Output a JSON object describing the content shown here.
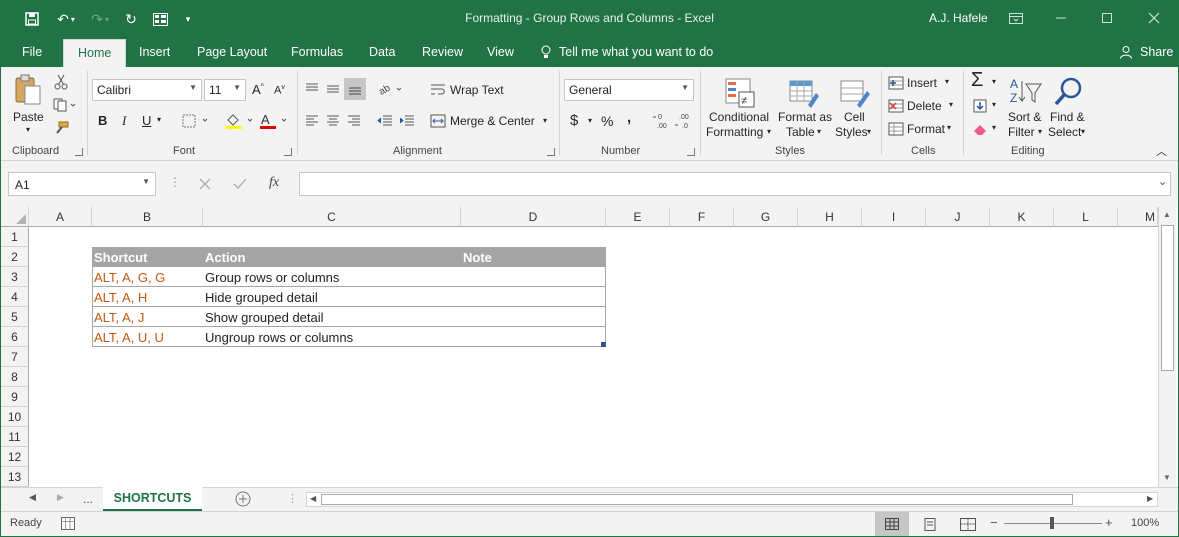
{
  "window": {
    "title": "Formatting - Group Rows and Columns  -  Excel",
    "user": "A.J. Hafele"
  },
  "tabs": [
    "File",
    "Home",
    "Insert",
    "Page Layout",
    "Formulas",
    "Data",
    "Review",
    "View"
  ],
  "tell_me": "Tell me what you want to do",
  "share": "Share",
  "ribbon": {
    "clipboard": {
      "paste": "Paste",
      "label": "Clipboard"
    },
    "font": {
      "name": "Calibri",
      "size": "11",
      "label": "Font",
      "bold": "B",
      "italic": "I",
      "underline": "U"
    },
    "alignment": {
      "wrap": "Wrap Text",
      "merge": "Merge & Center",
      "label": "Alignment"
    },
    "number": {
      "format": "General",
      "label": "Number",
      "currency": "$",
      "percent": "%",
      "comma": ","
    },
    "styles": {
      "cond1": "Conditional",
      "cond2": "Formatting",
      "table1": "Format as",
      "table2": "Table",
      "cell1": "Cell",
      "cell2": "Styles",
      "label": "Styles"
    },
    "cells": {
      "insert": "Insert",
      "delete": "Delete",
      "format": "Format",
      "label": "Cells"
    },
    "editing": {
      "sort1": "Sort &",
      "sort2": "Filter",
      "find1": "Find &",
      "find2": "Select",
      "label": "Editing"
    }
  },
  "namebox": "A1",
  "fx": "fx",
  "columns": [
    "A",
    "B",
    "C",
    "D",
    "E",
    "F",
    "G",
    "H",
    "I",
    "J",
    "K",
    "L",
    "M"
  ],
  "rows": [
    "1",
    "2",
    "3",
    "4",
    "5",
    "6",
    "7",
    "8",
    "9",
    "10",
    "11",
    "12",
    "13"
  ],
  "table": {
    "headers": [
      "Shortcut",
      "Action",
      "Note"
    ],
    "rows": [
      [
        "ALT, A, G, G",
        "Group rows or columns"
      ],
      [
        "ALT, A, H",
        "Hide grouped detail"
      ],
      [
        "ALT, A, J",
        "Show grouped detail"
      ],
      [
        "ALT, A, U, U",
        "Ungroup rows or columns"
      ]
    ]
  },
  "sheet": {
    "ellipsis": "...",
    "name": "SHORTCUTS"
  },
  "status": {
    "ready": "Ready",
    "zoom": "100%"
  }
}
